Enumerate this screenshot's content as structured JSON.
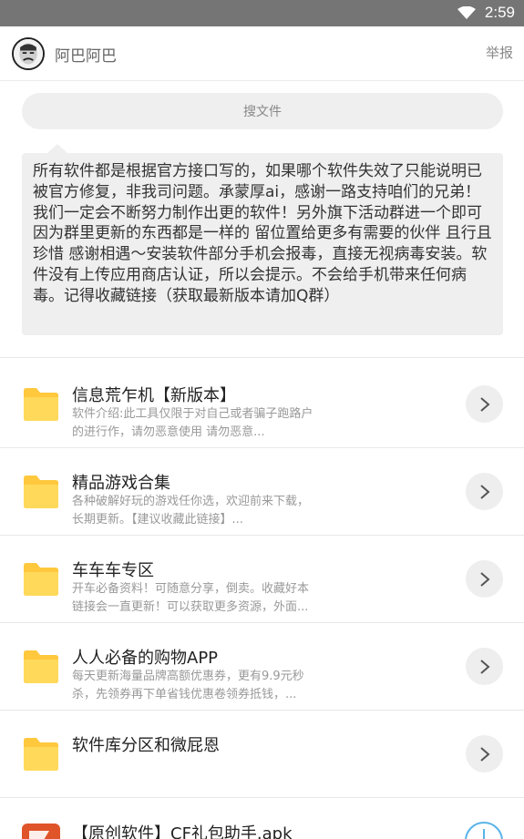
{
  "status_bar": {
    "time": "2:59",
    "wifi_icon": "wifi-icon"
  },
  "header": {
    "username": "阿巴阿巴",
    "report_label": "举报"
  },
  "search": {
    "label": "搜文件"
  },
  "notice": {
    "text": "所有软件都是根据官方接口写的，如果哪个软件失效了只能说明已被官方修复，非我司问题。承蒙厚ai，感谢一路支持咱们的兄弟！我们一定会不断努力制作出更的软件！另外旗下活动群进一个即可 因为群里更新的东西都是一样的 留位置给更多有需要的伙伴 且行且珍惜 感谢相遇～安装软件部分手机会报毒，直接无视病毒安装。软件没有上传应用商店认证，所以会提示。不会给手机带来任何病毒。记得收藏链接（获取最新版本请加Q群）"
  },
  "folders": [
    {
      "title": "信息荒乍机【新版本】",
      "desc_line1": "软件介绍:此工具仅限于对自己或者骗子跑路户",
      "desc_line2": "的进行作，请勿恶意使用 请勿恶意..."
    },
    {
      "title": "精品游戏合集",
      "desc_line1": "各种破解好玩的游戏任你选，欢迎前来下载，",
      "desc_line2": "长期更新。【建议收藏此链接】..."
    },
    {
      "title": "车车车专区",
      "desc_line1": "开车必备资料！可随意分享，倒卖。收藏好本",
      "desc_line2": "链接会一直更新！可以获取更多资源，外面..."
    },
    {
      "title": "人人必备的购物APP",
      "desc_line1": "每天更新海量品牌高额优惠券，更有9.9元秒",
      "desc_line2": "杀，先领券再下单省钱优惠卷领券抵钱，..."
    },
    {
      "title": "软件库分区和微屁恩",
      "desc_line1": "",
      "desc_line2": ""
    }
  ],
  "file": {
    "title": "【原创软件】CF礼包助手.apk"
  },
  "colors": {
    "folder_yellow": "#FFD54F",
    "apk_orange": "#E0542A",
    "download_blue": "#5AB3E8"
  }
}
